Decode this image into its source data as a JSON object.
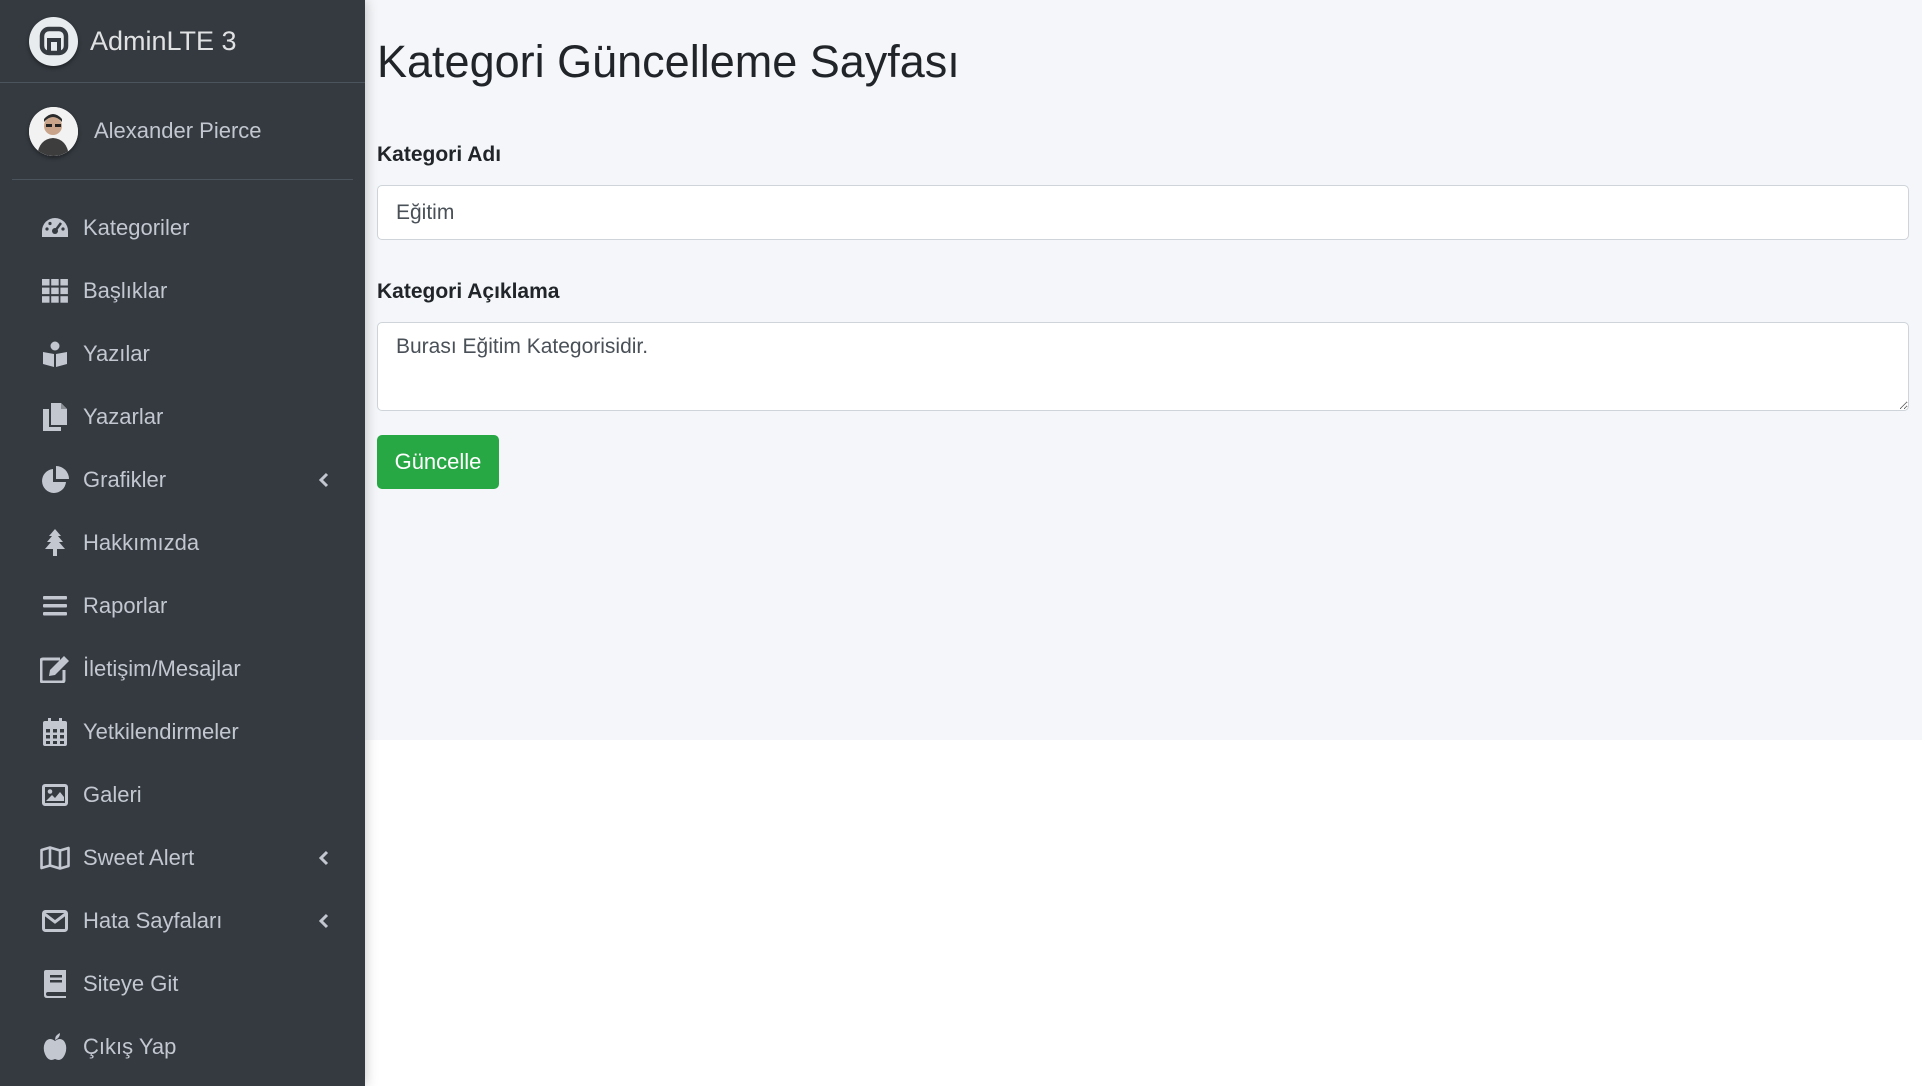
{
  "brand": {
    "name": "AdminLTE 3"
  },
  "user": {
    "name": "Alexander Pierce"
  },
  "sidebar": {
    "items": [
      {
        "label": "Kategoriler",
        "icon": "tachometer-icon",
        "has_children": false
      },
      {
        "label": "Başlıklar",
        "icon": "grid-icon",
        "has_children": false
      },
      {
        "label": "Yazılar",
        "icon": "book-reader-icon",
        "has_children": false
      },
      {
        "label": "Yazarlar",
        "icon": "copy-icon",
        "has_children": false
      },
      {
        "label": "Grafikler",
        "icon": "chart-pie-icon",
        "has_children": true
      },
      {
        "label": "Hakkımızda",
        "icon": "tree-icon",
        "has_children": false
      },
      {
        "label": "Raporlar",
        "icon": "bars-icon",
        "has_children": false
      },
      {
        "label": "İletişim/Mesajlar",
        "icon": "edit-icon",
        "has_children": false
      },
      {
        "label": "Yetkilendirmeler",
        "icon": "calendar-icon",
        "has_children": false
      },
      {
        "label": "Galeri",
        "icon": "image-icon",
        "has_children": false
      },
      {
        "label": "Sweet Alert",
        "icon": "map-icon",
        "has_children": true
      },
      {
        "label": "Hata Sayfaları",
        "icon": "envelope-icon",
        "has_children": true
      },
      {
        "label": "Siteye Git",
        "icon": "book-icon",
        "has_children": false
      },
      {
        "label": "Çıkış Yap",
        "icon": "apple-icon",
        "has_children": false
      }
    ]
  },
  "main": {
    "title": "Kategori Güncelleme Sayfası",
    "form": {
      "name_label": "Kategori Adı",
      "name_value": "Eğitim",
      "description_label": "Kategori Açıklama",
      "description_value": "Burası Eğitim Kategorisidir.",
      "submit_label": "Güncelle"
    }
  },
  "colors": {
    "sidebar_bg": "#343a40",
    "content_bg": "#f4f6f9",
    "success": "#28a745",
    "nav_text": "#c2c7d0"
  }
}
